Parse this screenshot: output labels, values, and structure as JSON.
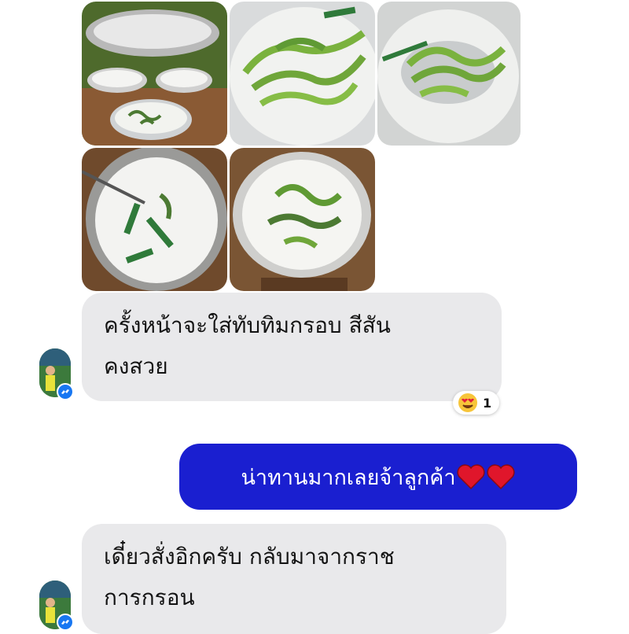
{
  "photos": [
    {
      "name": "dessert-bowls-outdoor"
    },
    {
      "name": "green-noodles-in-coconut-milk-closeup"
    },
    {
      "name": "green-noodles-spoon-closeup"
    },
    {
      "name": "coconut-milk-pot-with-pandan"
    },
    {
      "name": "dessert-cup-topdown"
    }
  ],
  "messages": [
    {
      "from": "contact",
      "lines": [
        "ครั้งหน้าจะใส่ทับทิมกรอบ สีสัน",
        "คงสวย"
      ],
      "reaction": {
        "emoji": "heart-eyes",
        "count": "1"
      }
    },
    {
      "from": "me",
      "text": "น่าทานมากเลยจ้าลูกค้า",
      "hearts": 2
    },
    {
      "from": "contact",
      "lines": [
        "เดี๋ยวสั่งอิกครับ กลับมาจากราช",
        "การกรอน"
      ]
    }
  ],
  "colors": {
    "incoming_bubble": "#e9e9eb",
    "outgoing_bubble": "#1a1fd0",
    "messenger_badge": "#1877f2"
  }
}
